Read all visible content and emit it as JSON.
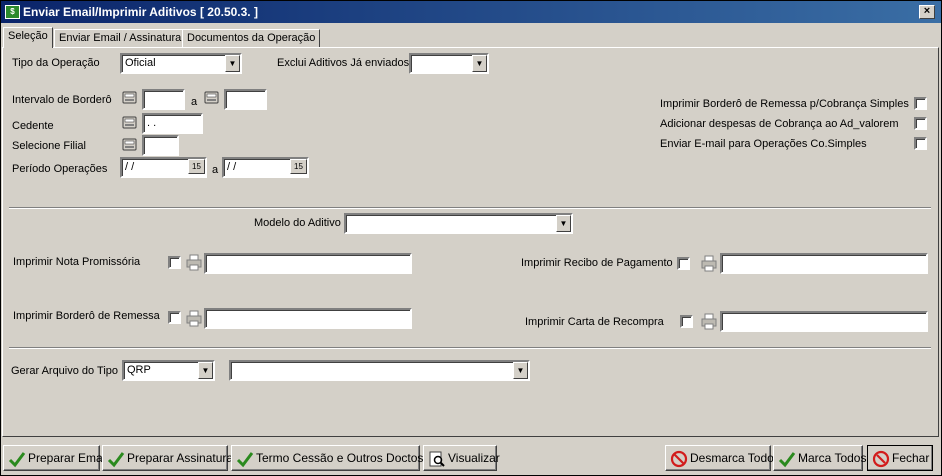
{
  "window": {
    "title": "Enviar Email/Imprimir Aditivos [ 20.50.3. ]",
    "close_label": "×"
  },
  "tabs": [
    {
      "label": "Seleção",
      "active": true
    },
    {
      "label": "Enviar Email / Assinatura",
      "active": false
    },
    {
      "label": "Documentos da Operação",
      "active": false
    }
  ],
  "form": {
    "tipo_operacao": {
      "label": "Tipo da Operação",
      "value": "Oficial"
    },
    "exclui_aditivos": {
      "label": "Exclui Aditivos Já enviados",
      "value": ""
    },
    "intervalo_bordero": {
      "label": "Intervalo de Borderô",
      "from": "",
      "sep": "a",
      "to": ""
    },
    "cedente": {
      "label": "Cedente",
      "value": ". ."
    },
    "filial": {
      "label": "Selecione Filial",
      "value": ""
    },
    "periodo": {
      "label": "Período Operações",
      "from": "/ /",
      "sep": "a",
      "to": "/ /",
      "cal_label": "15"
    },
    "options": [
      {
        "label": "Imprimir  Borderô de Remessa p/Cobrança Simples",
        "checked": false
      },
      {
        "label": "Adicionar despesas de Cobrança ao Ad_valorem",
        "checked": false
      },
      {
        "label": "Enviar E-mail para Operações Co.Simples",
        "checked": false
      }
    ],
    "modelo_aditivo": {
      "label": "Modelo do Aditivo",
      "value": ""
    },
    "nota_promissoria": {
      "label": "Imprimir Nota Promissória",
      "checked": false,
      "path": ""
    },
    "recibo_pagamento": {
      "label": "Imprimir Recibo de Pagamento",
      "checked": false,
      "path": ""
    },
    "bordero_remessa": {
      "label": "Imprimir Borderô de Remessa",
      "checked": false,
      "path": ""
    },
    "carta_recompra": {
      "label": "Imprimir Carta de Recompra",
      "checked": false,
      "path": ""
    },
    "gerar_arquivo": {
      "label": "Gerar Arquivo do Tipo",
      "type_value": "QRP",
      "second_value": ""
    }
  },
  "footer": {
    "preparar_email": "Preparar Email",
    "preparar_assinatura": "Preparar Assinatura",
    "termo_cessao": "Termo Cessão e Outros Doctos",
    "visualizar": "Visualizar",
    "desmarca_todos": "Desmarca Todos",
    "marca_todos": "Marca Todos",
    "fechar": "Fechar"
  },
  "colors": {
    "title_bar": "#0a246a",
    "check_green": "#2a8a1e",
    "stop_red": "#d21c1c"
  }
}
